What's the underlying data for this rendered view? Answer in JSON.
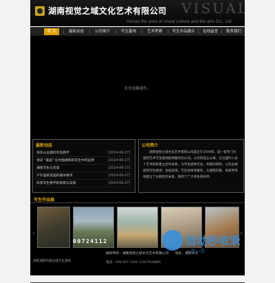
{
  "header": {
    "company_name": "湖南视觉之域文化艺术有限公司",
    "brand_word": "VISUAL",
    "slogan": "Hunan the area of visual culture and the arts Co., Ltd."
  },
  "nav": {
    "items": [
      {
        "label": "首  页",
        "active": true
      },
      {
        "label": "最新动态"
      },
      {
        "label": "公司简介"
      },
      {
        "label": "写生基地"
      },
      {
        "label": "艺术考察"
      },
      {
        "label": "写生作品展示"
      },
      {
        "label": "在线留言"
      },
      {
        "label": "联系我们"
      }
    ]
  },
  "notice": "无法加载插件。",
  "news": {
    "title": "最新动态",
    "rows": [
      {
        "title": "清凉山主题的写生教学",
        "date": "[2014-06-27]"
      },
      {
        "title": "清凉 \"美画\" 在中国湖南的写生中的运用",
        "date": "[2014-06-27]"
      },
      {
        "title": "湖南写生与写意",
        "date": "[2014-06-27]"
      },
      {
        "title": "户外画家说画的基本要求",
        "date": "[2014-06-27]"
      },
      {
        "title": "风景写生教学的探索与实践",
        "date": "[2014-06-27]"
      }
    ]
  },
  "intro": {
    "title": "公司简介",
    "text": "湖南视觉之域文化艺术有限公司成立于2009年，是一家专门为画院艺术写生基地提供服务的公司。公司的成立以来，已与国内十多个艺术院校建立合作关系，为学生提供写生、考察的场所。公司主要提供写生接待、住宿安排、写生指导等服务，与湘西凤凰、张家界等地建立了长期合作关系，受到了广大师生的好评。"
  },
  "gallery": {
    "title": "写生作品展",
    "prev_arrow": "‹",
    "next_arrow": "›"
  },
  "footer": {
    "counter": "00724112",
    "address": "版权所有：湖南视觉之域文化艺术有限公司　　地址：湖南长沙",
    "phone": "电话：400-007-1550  13307934885",
    "left": "湖南湘西凤凰古城写生基地"
  },
  "watermark": {
    "text": "自动秒收录",
    "sub": "一次一次"
  }
}
